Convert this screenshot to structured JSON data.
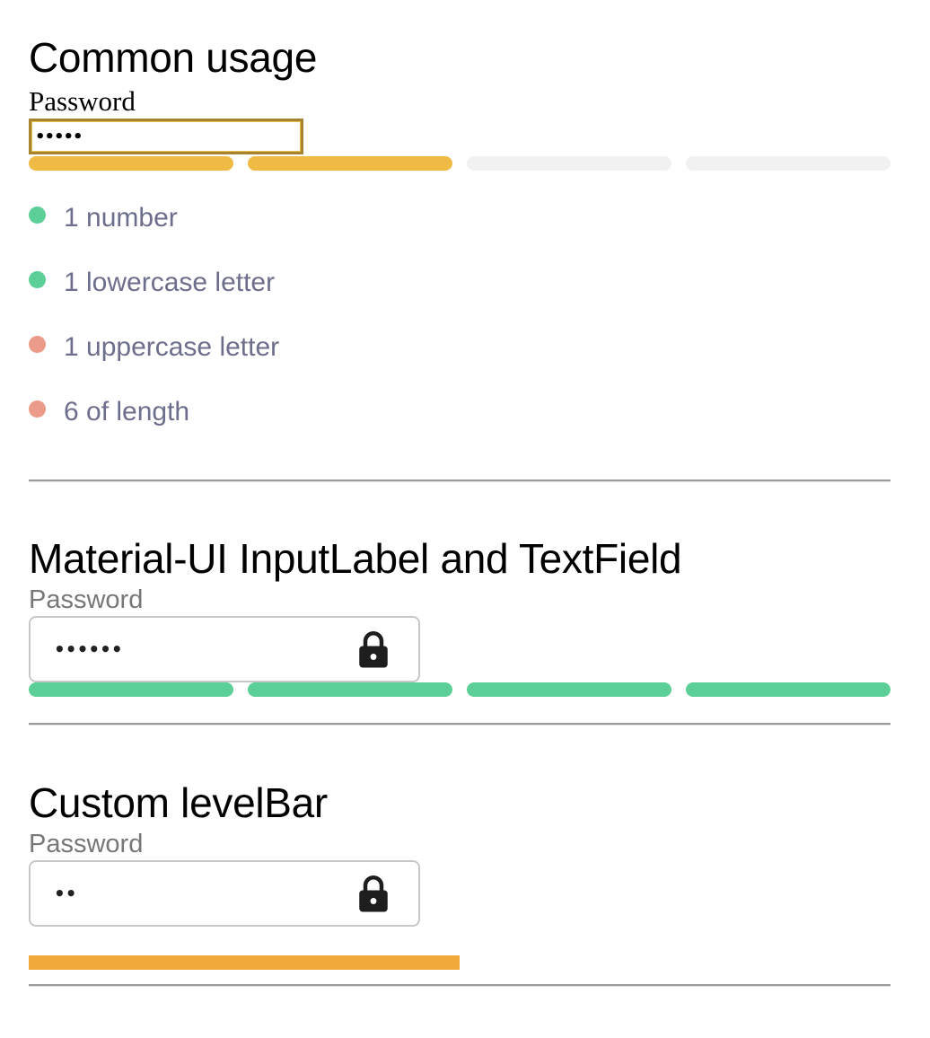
{
  "common_usage": {
    "title": "Common usage",
    "label": "Password",
    "value_masked": "•••••",
    "strength_level": 2,
    "strength_max": 4,
    "bar_active_color": "#f0bb45",
    "bar_inactive_color": "#f1f1f1",
    "rules": [
      {
        "text": "1 number",
        "passed": true
      },
      {
        "text": "1 lowercase letter",
        "passed": true
      },
      {
        "text": "1 uppercase letter",
        "passed": false
      },
      {
        "text": "6 of length",
        "passed": false
      }
    ],
    "pass_color": "#5ccf98",
    "fail_color": "#ec9b8a"
  },
  "material_ui": {
    "title": "Material-UI InputLabel and TextField",
    "label": "Password",
    "value_masked": "••••••",
    "icon": "lock-icon",
    "strength_level": 4,
    "strength_max": 4,
    "bar_active_color": "#5ccf98"
  },
  "custom_levelbar": {
    "title": "Custom levelBar",
    "label": "Password",
    "value_masked": "••",
    "icon": "lock-icon",
    "level_fraction": 0.5,
    "bar_color": "#f1a93b"
  }
}
